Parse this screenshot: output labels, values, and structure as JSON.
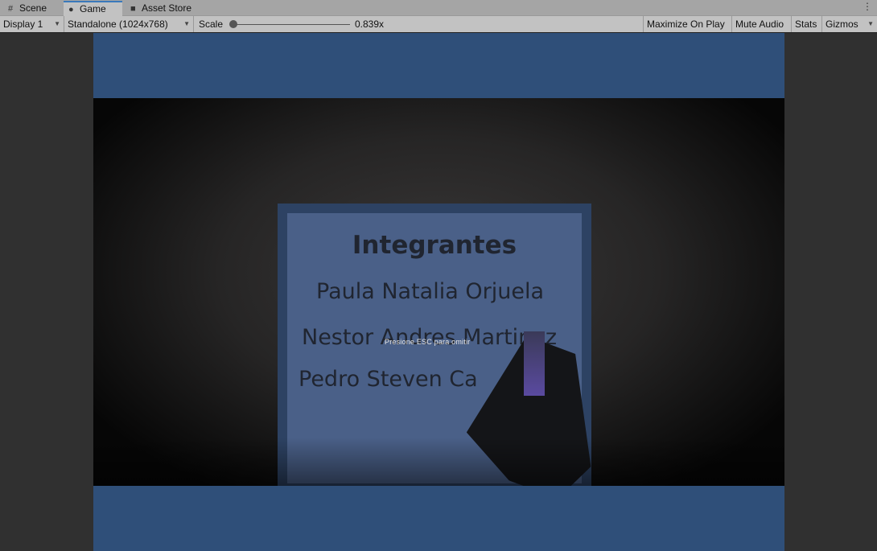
{
  "tabs": [
    {
      "label": "Scene",
      "icon": "grid-icon"
    },
    {
      "label": "Game",
      "icon": "gamepad-icon",
      "active": true
    },
    {
      "label": "Asset Store",
      "icon": "shopping-bag-icon"
    }
  ],
  "toolbar": {
    "display": "Display 1",
    "resolution": "Standalone (1024x768)",
    "scale_label": "Scale",
    "scale_value": "0.839x",
    "maximize": "Maximize On Play",
    "mute": "Mute Audio",
    "stats": "Stats",
    "gizmos": "Gizmos"
  },
  "game": {
    "title": "Integrantes",
    "names": [
      "Paula Natalia Orjuela",
      "Nestor Andres Martinez",
      "Pedro Steven Ca"
    ],
    "skip_hint": "Presione ESC para omitir"
  },
  "colors": {
    "viewport_bg": "#2f4f79",
    "editor_bg": "#303030"
  }
}
